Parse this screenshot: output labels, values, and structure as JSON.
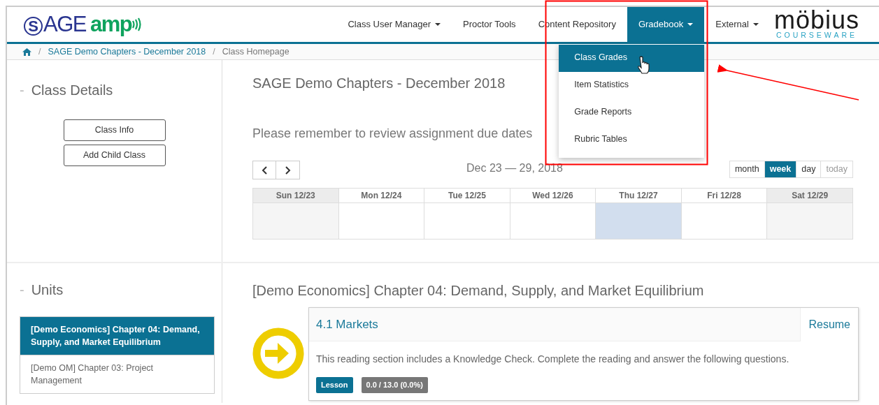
{
  "logo": {
    "brand": "SAGE",
    "product": "amp"
  },
  "nav": [
    {
      "label": "Class User Manager",
      "dropdown": true,
      "selected": false
    },
    {
      "label": "Proctor Tools",
      "dropdown": false,
      "selected": false
    },
    {
      "label": "Content Repository",
      "dropdown": false,
      "selected": false
    },
    {
      "label": "Gradebook",
      "dropdown": true,
      "selected": true,
      "menu": [
        {
          "label": "Class Grades",
          "selected": true
        },
        {
          "label": "Item Statistics",
          "selected": false
        },
        {
          "label": "Grade Reports",
          "selected": false
        },
        {
          "label": "Rubric Tables",
          "selected": false
        }
      ]
    },
    {
      "label": "External",
      "dropdown": true,
      "selected": false
    }
  ],
  "partner_logo": {
    "name": "möbius",
    "tagline": "COURSEWARE"
  },
  "breadcrumb": [
    {
      "kind": "home"
    },
    {
      "kind": "separator",
      "text": "/"
    },
    {
      "kind": "link",
      "text": "SAGE Demo Chapters - December 2018"
    },
    {
      "kind": "separator",
      "text": "/"
    },
    {
      "kind": "current",
      "text": "Class Homepage"
    }
  ],
  "class_details": {
    "marker": "-",
    "title": "Class Details",
    "buttons": [
      "Class Info",
      "Add Child Class"
    ]
  },
  "units": {
    "marker": "-",
    "title": "Units",
    "items": [
      {
        "label": "[Demo Economics] Chapter 04: Demand, Supply, and Market Equilibrium",
        "selected": true
      },
      {
        "label": "[Demo OM] Chapter 03: Project Management",
        "selected": false
      }
    ]
  },
  "class_title": "SAGE Demo Chapters - December 2018",
  "notice": "Please remember to review assignment due dates",
  "calendar": {
    "title": "Dec 23 — 29, 2018",
    "views": [
      {
        "label": "month",
        "selected": false,
        "disabled": false
      },
      {
        "label": "week",
        "selected": true,
        "disabled": false
      },
      {
        "label": "day",
        "selected": false,
        "disabled": false
      },
      {
        "label": "today",
        "selected": false,
        "disabled": true
      }
    ],
    "days": [
      {
        "label": "Sun 12/23",
        "weekend": true,
        "today": false
      },
      {
        "label": "Mon 12/24",
        "weekend": false,
        "today": false
      },
      {
        "label": "Tue 12/25",
        "weekend": false,
        "today": false
      },
      {
        "label": "Wed 12/26",
        "weekend": false,
        "today": false
      },
      {
        "label": "Thu 12/27",
        "weekend": false,
        "today": true
      },
      {
        "label": "Fri 12/28",
        "weekend": false,
        "today": false
      },
      {
        "label": "Sat 12/29",
        "weekend": true,
        "today": false
      }
    ]
  },
  "unit_title": "[Demo Economics] Chapter 04: Demand, Supply, and Market Equilibrium",
  "lesson": {
    "title": "4.1 Markets",
    "action": "Resume",
    "description": "This reading section includes a Knowledge Check. Complete the reading and answer the following questions.",
    "badges": [
      {
        "text": "Lesson",
        "kind": "type"
      },
      {
        "text": "0.0 / 13.0 (0.0%)",
        "kind": "score"
      }
    ]
  }
}
